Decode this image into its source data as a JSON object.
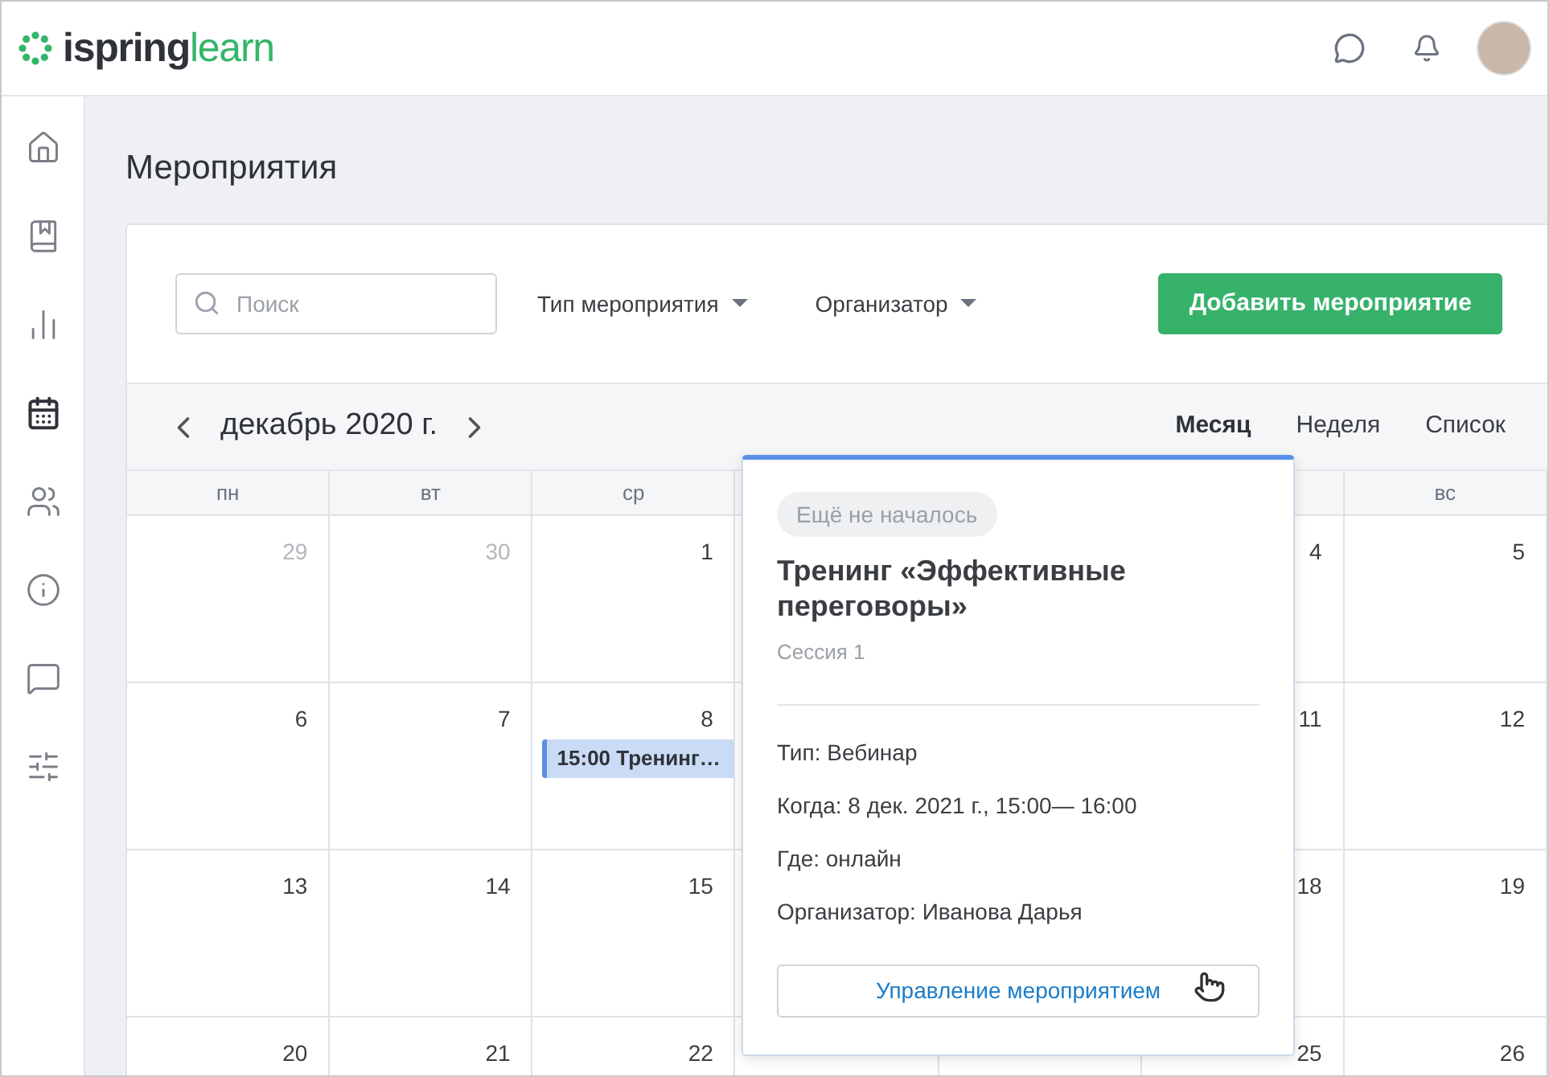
{
  "header": {
    "logo": {
      "brand": "ispring",
      "product": "learn"
    }
  },
  "sidebar": {
    "items": [
      {
        "selected": false
      },
      {
        "selected": false
      },
      {
        "selected": false
      },
      {
        "selected": true
      },
      {
        "selected": false
      },
      {
        "selected": false
      },
      {
        "selected": false
      },
      {
        "selected": false
      }
    ]
  },
  "page": {
    "title": "Мероприятия"
  },
  "toolbar": {
    "search": {
      "placeholder": "Поиск"
    },
    "filters": [
      "Тип мероприятия",
      "Организатор"
    ],
    "add_button": "Добавить мероприятие"
  },
  "calendar": {
    "period": "декабрь 2020 г.",
    "views": [
      {
        "label": "Месяц",
        "selected": true
      },
      {
        "label": "Неделя",
        "selected": false
      },
      {
        "label": "Список",
        "selected": false
      }
    ],
    "weekdays": {
      "start": [
        "пн",
        "вт",
        "ср"
      ],
      "end": [
        "вс"
      ]
    },
    "weeks": [
      {
        "start": [
          {
            "day": "29",
            "muted": true
          },
          {
            "day": "30",
            "muted": true
          },
          {
            "day": "1",
            "muted": false
          }
        ],
        "end": [
          {
            "day": "4",
            "muted": false
          },
          {
            "day": "5",
            "muted": false
          }
        ]
      },
      {
        "start": [
          {
            "day": "6",
            "muted": false
          },
          {
            "day": "7",
            "muted": false
          },
          {
            "day": "8",
            "muted": false,
            "events": [
              "15:00 Тренинг…"
            ]
          }
        ],
        "end": [
          {
            "day": "11",
            "muted": false
          },
          {
            "day": "12",
            "muted": false
          }
        ]
      },
      {
        "start": [
          {
            "day": "13",
            "muted": false
          },
          {
            "day": "14",
            "muted": false
          },
          {
            "day": "15",
            "muted": false
          }
        ],
        "end": [
          {
            "day": "18",
            "muted": false
          },
          {
            "day": "19",
            "muted": false
          }
        ]
      },
      {
        "start": [
          {
            "day": "20",
            "muted": false
          },
          {
            "day": "21",
            "muted": false
          },
          {
            "day": "22",
            "muted": false
          }
        ],
        "end": [
          {
            "day": "25",
            "muted": false
          },
          {
            "day": "26",
            "muted": false
          }
        ]
      }
    ]
  },
  "popup": {
    "status": "Ещё не началось",
    "title": "Тренинг «Эффективные переговоры»",
    "session": "Сессия 1",
    "details": [
      "Тип: Вебинар",
      "Когда: 8 дек. 2021 г., 15:00— 16:00",
      "Где: онлайн",
      "Организатор: Иванова Дарья"
    ],
    "button": "Управление мероприятием"
  }
}
